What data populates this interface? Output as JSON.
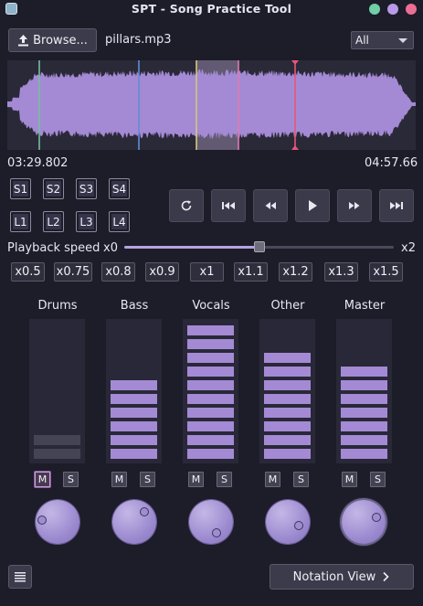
{
  "window": {
    "title": "SPT - Song Practice Tool",
    "controls": [
      {
        "name": "minimize",
        "color": "#6fcfa8"
      },
      {
        "name": "maximize",
        "color": "#b79ae8"
      },
      {
        "name": "close",
        "color": "#ec6f93"
      }
    ]
  },
  "toolbar": {
    "browse_label": "Browse...",
    "filename": "pillars.mp3",
    "track_select": "All"
  },
  "waveform": {
    "start_time": "03:29.802",
    "end_time": "04:57.66",
    "wave_color": "#a48ad4",
    "selection_color": "#cbb8e0",
    "markers": [
      {
        "name": "marker-green",
        "color": "#6fc29a"
      },
      {
        "name": "marker-blue",
        "color": "#5e8ed6"
      },
      {
        "name": "marker-yellow",
        "color": "#d8c77a"
      },
      {
        "name": "marker-pink",
        "color": "#e07ab0"
      },
      {
        "name": "marker-red",
        "color": "#e85677"
      }
    ]
  },
  "sections": {
    "s": [
      "S1",
      "S2",
      "S3",
      "S4"
    ],
    "l": [
      "L1",
      "L2",
      "L3",
      "L4"
    ]
  },
  "transport": [
    {
      "name": "loop-icon"
    },
    {
      "name": "skip-to-start-icon"
    },
    {
      "name": "rewind-icon"
    },
    {
      "name": "play-icon"
    },
    {
      "name": "fast-forward-icon"
    },
    {
      "name": "skip-to-end-icon"
    }
  ],
  "speed": {
    "label": "Playback speed",
    "min": "x0",
    "max": "x2",
    "value_fraction": 0.5,
    "presets": [
      "x0.5",
      "x0.75",
      "x0.8",
      "x0.9",
      "x1",
      "x1.1",
      "x1.2",
      "x1.3",
      "x1.5"
    ]
  },
  "mixer": {
    "meter_color": "#a48ad4",
    "meter_dim_color": "#454454",
    "channels": [
      {
        "label": "Drums",
        "level_segments": 2,
        "dim": true,
        "mute": "M",
        "solo": "S",
        "mute_active": true
      },
      {
        "label": "Bass",
        "level_segments": 6,
        "dim": false,
        "mute": "M",
        "solo": "S",
        "mute_active": false
      },
      {
        "label": "Vocals",
        "level_segments": 10,
        "dim": false,
        "mute": "M",
        "solo": "S",
        "mute_active": false
      },
      {
        "label": "Other",
        "level_segments": 8,
        "dim": false,
        "mute": "M",
        "solo": "S",
        "mute_active": false
      },
      {
        "label": "Master",
        "level_segments": 7,
        "dim": false,
        "mute": "M",
        "solo": "S",
        "mute_active": false
      }
    ]
  },
  "footer": {
    "notation_label": "Notation View"
  }
}
